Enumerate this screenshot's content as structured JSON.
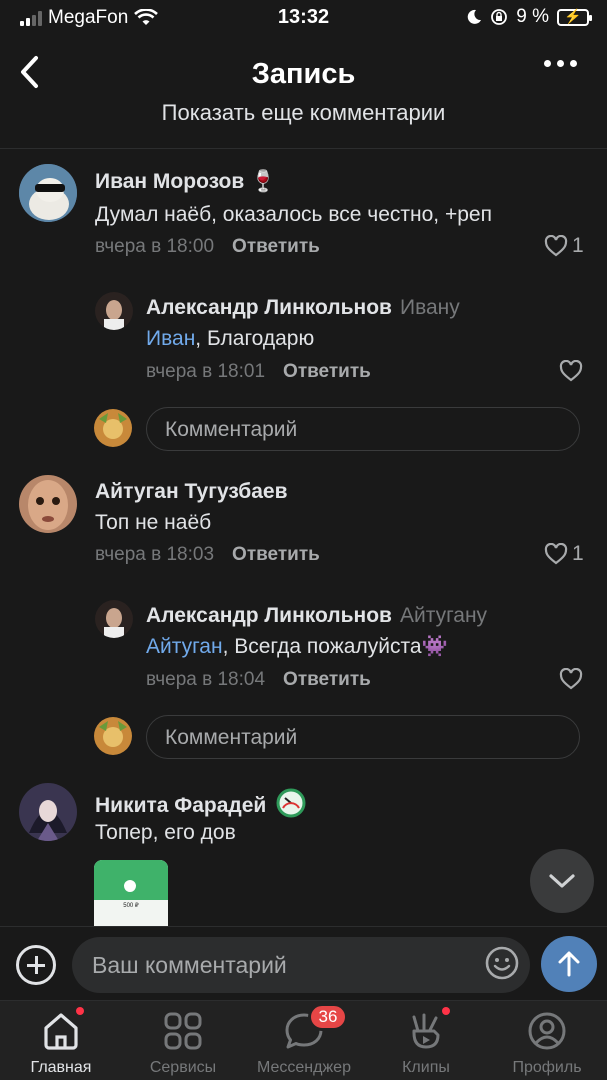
{
  "status_bar": {
    "carrier": "MegaFon",
    "time": "13:32",
    "battery": "9 %"
  },
  "header": {
    "title": "Запись"
  },
  "show_more": "Показать еще комментарии",
  "comments": [
    {
      "name": "Иван Морозов",
      "emoji": "🍷",
      "text": "Думал наёб, оказалось все честно, +реп",
      "time": "вчера в 18:00",
      "reply": "Ответить",
      "likes": "1"
    },
    {
      "name": "Александр Линкольнов",
      "to": "Ивану",
      "mention": "Иван",
      "text": ", Благодарю",
      "time": "вчера в 18:01",
      "reply": "Ответить"
    },
    {
      "name": "Айтуган Тугузбаев",
      "text": "Топ не наёб",
      "time": "вчера в 18:03",
      "reply": "Ответить",
      "likes": "1"
    },
    {
      "name": "Александр Линкольнов",
      "to": "Айтугану",
      "mention": "Айтуган",
      "text": ", Всегда пожалуйста👾",
      "time": "вчера в 18:04",
      "reply": "Ответить"
    },
    {
      "name": "Никита Фарадей",
      "text": "Топер, его дов"
    }
  ],
  "thread_reply_placeholder": "Комментарий",
  "attachment": {
    "label": "500 ₽"
  },
  "input": {
    "placeholder": "Ваш комментарий"
  },
  "tabs": [
    {
      "label": "Главная",
      "icon": "home-icon"
    },
    {
      "label": "Сервисы",
      "icon": "services-icon"
    },
    {
      "label": "Мессенджер",
      "icon": "messenger-icon",
      "badge": "36"
    },
    {
      "label": "Клипы",
      "icon": "clips-icon"
    },
    {
      "label": "Профиль",
      "icon": "profile-icon"
    }
  ],
  "colors": {
    "background": "#191919",
    "mention": "#71aaeb",
    "accent": "#5181b8",
    "badge": "#e64646"
  }
}
